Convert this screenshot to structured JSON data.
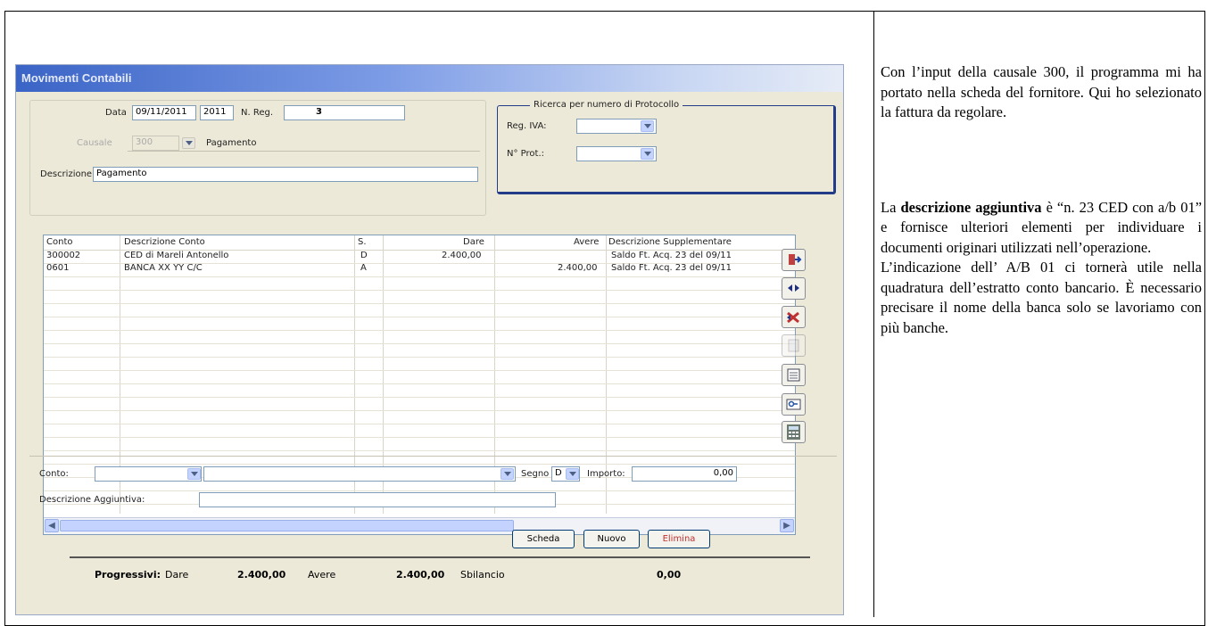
{
  "window": {
    "title": "Movimenti Contabili"
  },
  "header": {
    "data_label": "Data",
    "data_value": "09/11/2011",
    "year_value": "2011",
    "nreg_label": "N. Reg.",
    "nreg_value": "3",
    "causale_label": "Causale",
    "causale_value": "300",
    "causale_desc": "Pagamento",
    "descrizione_label": "Descrizione",
    "descrizione_value": "Pagamento"
  },
  "protocol_search": {
    "title": "Ricerca per numero di Protocollo",
    "reg_iva_label": "Reg. IVA:",
    "reg_iva_value": "",
    "nprot_label": "N° Prot.:",
    "nprot_value": ""
  },
  "grid": {
    "columns": [
      "Conto",
      "Descrizione Conto",
      "S.",
      "Dare",
      "Avere",
      "Descrizione Supplementare"
    ],
    "rows": [
      [
        "300002",
        "CED di Mareli Antonello",
        "D",
        "2.400,00",
        "",
        "Saldo Ft. Acq. 23 del 09/11"
      ],
      [
        "0601",
        "BANCA XX YY C/C",
        "A",
        "",
        "2.400,00",
        "Saldo Ft. Acq. 23 del 09/11"
      ]
    ]
  },
  "entry": {
    "conto_label": "Conto:",
    "conto_value": "",
    "conto_desc": "",
    "segno_label": "Segno",
    "segno_value": "D",
    "importo_label": "Importo:",
    "importo_value": "0,00",
    "desc_agg_label": "Descrizione Aggiuntiva:",
    "desc_agg_value": ""
  },
  "buttons": {
    "scheda": "Scheda",
    "nuovo": "Nuovo",
    "elimina": "Elimina"
  },
  "toolbar_icons": [
    "enter-icon",
    "move-rows-icon",
    "delete-rows-icon",
    "disabled-doc-icon",
    "form-icon",
    "key-icon",
    "calculator-icon"
  ],
  "totals": {
    "label": "Progressivi:",
    "dare_label": "Dare",
    "dare_value": "2.400,00",
    "avere_label": "Avere",
    "avere_value": "2.400,00",
    "sbilancio_label": "Sbilancio",
    "sbilancio_value": "0,00"
  },
  "commentary": {
    "p1": "Con l’input della causale 300, il programma mi ha portato nella scheda del fornitore. Qui ho selezionato la fattura da regolare.",
    "p2_pre": "La ",
    "p2_bold": "descrizione aggiuntiva",
    "p2_post": " è “n. 23 CED con a/b 01” e fornisce ulteriori elementi per individuare i documenti originari utilizzati nell’operazione.",
    "p3": "L’indicazione dell’ A/B 01 ci tornerà utile nella quadratura dell’estratto conto bancario. È necessario precisare il nome della banca solo se lavoriamo con più banche."
  }
}
